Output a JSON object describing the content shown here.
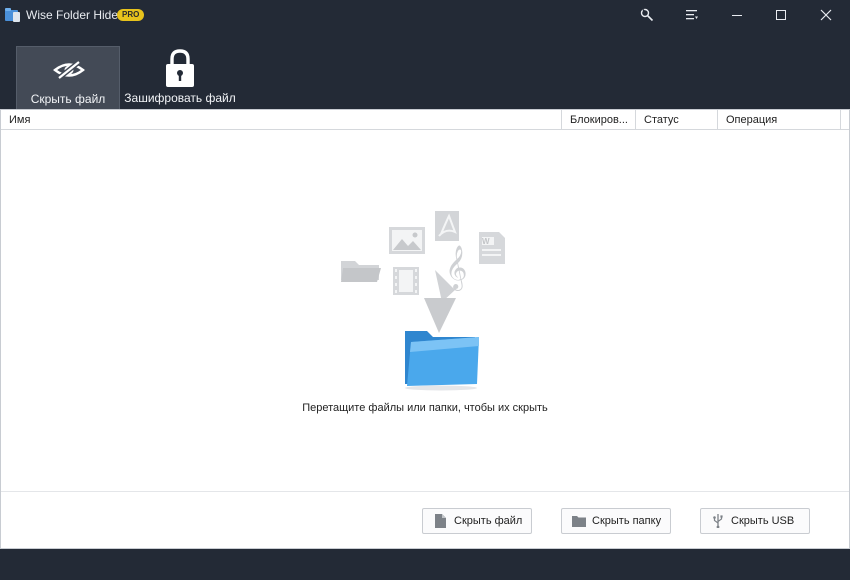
{
  "window": {
    "title": "Wise Folder Hider",
    "badge": "PRO",
    "controls": [
      "tools-icon",
      "menu-icon",
      "minimize-icon",
      "maximize-icon",
      "close-icon"
    ]
  },
  "toolbar": {
    "hide_file_label": "Скрыть файл",
    "encrypt_file_label": "Зашифровать файл"
  },
  "table": {
    "columns": [
      "Имя",
      "Блокиров...",
      "Статус",
      "Операция"
    ],
    "rows": []
  },
  "drop_zone": {
    "hint": "Перетащите файлы или папки, чтобы их скрыть"
  },
  "actions": {
    "hide_file": "Скрыть файл",
    "hide_folder": "Скрыть папку",
    "hide_usb": "Скрыть USB"
  },
  "colors": {
    "chrome_bg": "#232a36",
    "active_tool_bg": "#434a56",
    "badge": "#e7c21c",
    "folder_blue": "#3a9be0"
  }
}
